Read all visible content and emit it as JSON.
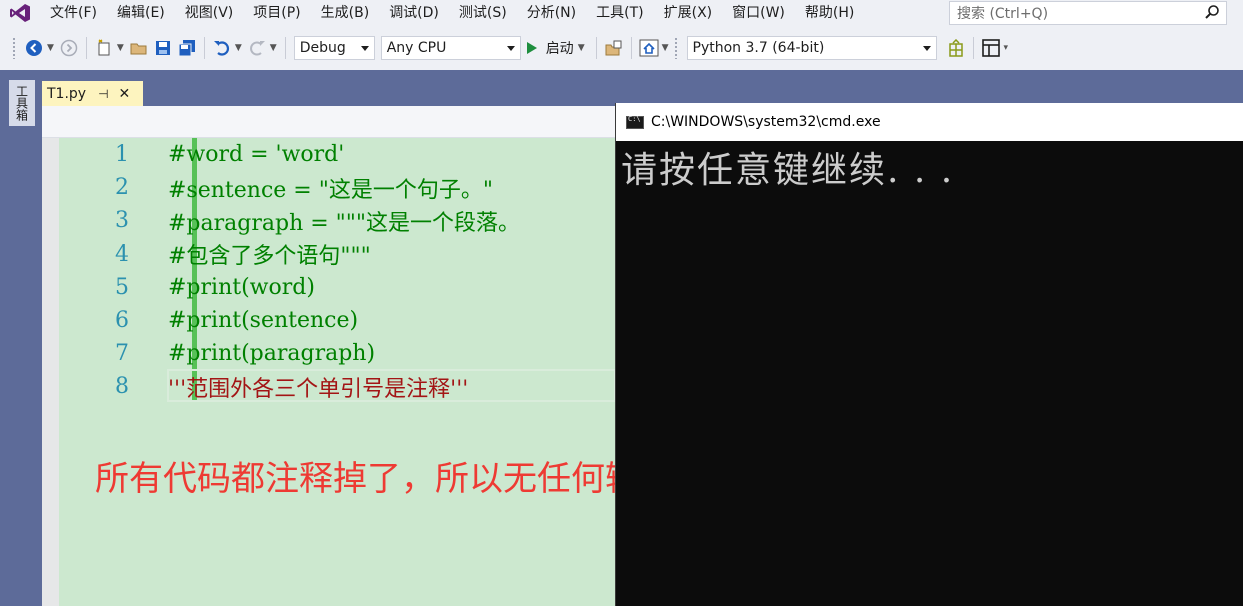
{
  "menubar": {
    "items": [
      "文件(F)",
      "编辑(E)",
      "视图(V)",
      "项目(P)",
      "生成(B)",
      "调试(D)",
      "测试(S)",
      "分析(N)",
      "工具(T)",
      "扩展(X)",
      "窗口(W)",
      "帮助(H)"
    ],
    "search_placeholder": "搜索 (Ctrl+Q)"
  },
  "toolbar": {
    "configuration": "Debug",
    "platform": "Any CPU",
    "start_label": "启动",
    "environment": "Python 3.7 (64-bit)"
  },
  "toolbox_label": "工具箱",
  "tab": {
    "title": "T1.py",
    "pin": "⊣",
    "close": "✕"
  },
  "editor": {
    "lines": [
      {
        "no": "1",
        "text": "#word = 'word'"
      },
      {
        "no": "2",
        "text": "#sentence = \"这是一个句子。\""
      },
      {
        "no": "3",
        "text": "#paragraph = \"\"\"这是一个段落。"
      },
      {
        "no": "4",
        "text": "#包含了多个语句\"\"\""
      },
      {
        "no": "5",
        "text": "#print(word)"
      },
      {
        "no": "6",
        "text": "#print(sentence)"
      },
      {
        "no": "7",
        "text": "#print(paragraph)"
      },
      {
        "no": "8",
        "text": "'''范围外各三个单引号是注释'''"
      }
    ],
    "annotation": "所有代码都注释掉了，所以无任何输出"
  },
  "console": {
    "title": "C:\\WINDOWS\\system32\\cmd.exe",
    "output": "请按任意键继续. . ."
  },
  "colors": {
    "editor_bg": "#cce8cf",
    "comment": "#008000",
    "string": "#a31515",
    "line_number": "#2b91af",
    "annotation": "#ee3a33",
    "console_bg": "#0c0c0c",
    "frame": "#5d6b99"
  }
}
